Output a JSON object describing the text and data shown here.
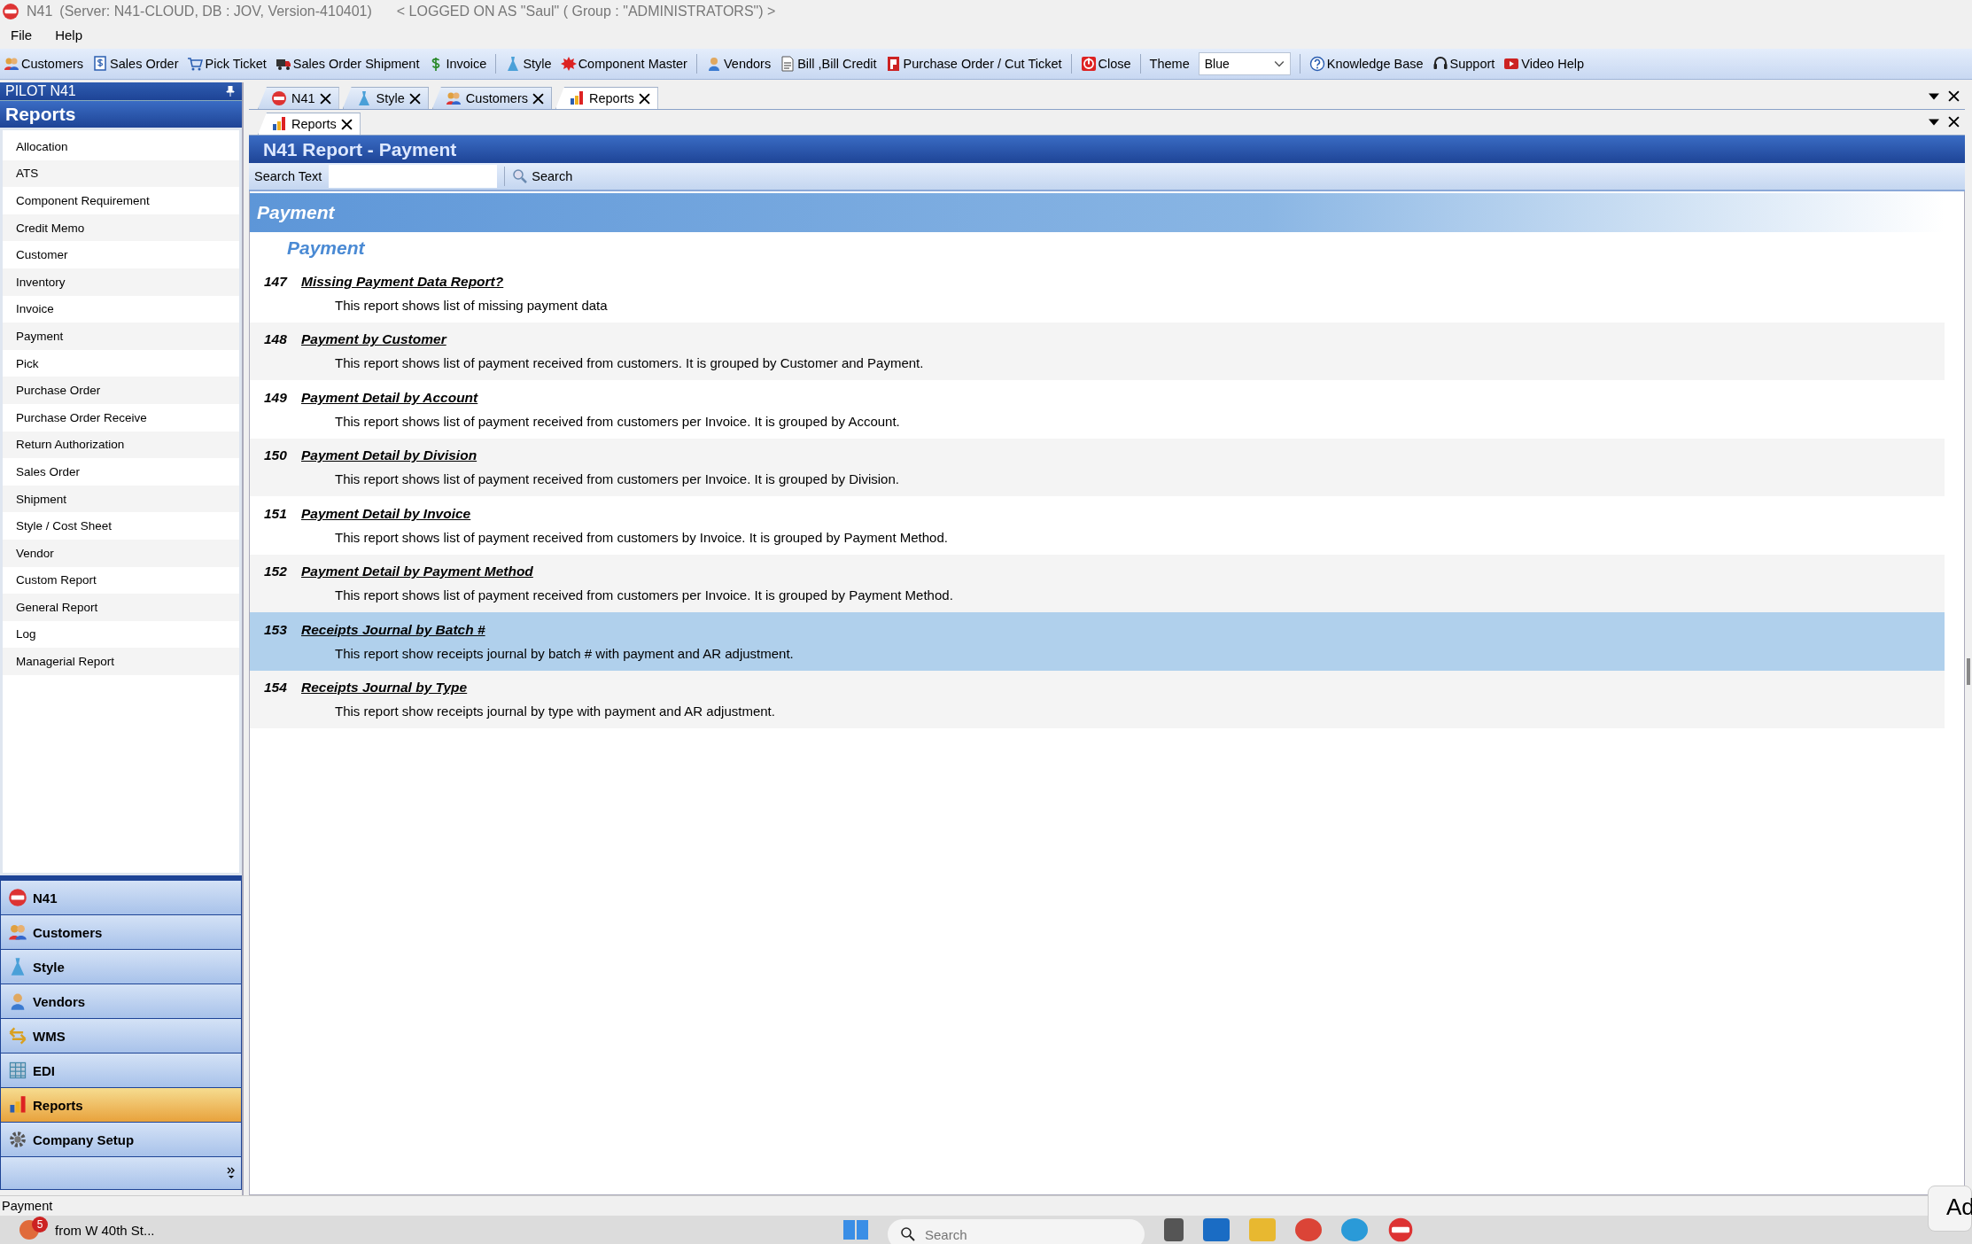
{
  "window": {
    "app": "N41",
    "title": "(Server: N41-CLOUD, DB : JOV, Version-410401)",
    "login": "< LOGGED ON AS \"Saul\" ( Group : \"ADMINISTRATORS\") >"
  },
  "menu": [
    "File",
    "Help"
  ],
  "toolbar": [
    {
      "kind": "people",
      "label": "Customers"
    },
    {
      "kind": "dollar-doc",
      "label": "Sales Order"
    },
    {
      "kind": "cart",
      "label": "Pick Ticket"
    },
    {
      "kind": "truck",
      "label": "Sales Order Shipment"
    },
    {
      "kind": "dollar",
      "label": "Invoice"
    },
    {
      "kind": "sep"
    },
    {
      "kind": "dress",
      "label": "Style"
    },
    {
      "kind": "burst",
      "label": "Component Master"
    },
    {
      "kind": "sep"
    },
    {
      "kind": "person",
      "label": "Vendors"
    },
    {
      "kind": "doc",
      "label": "Bill ,Bill Credit"
    },
    {
      "kind": "p",
      "label": "Purchase Order / Cut Ticket"
    },
    {
      "kind": "sep"
    },
    {
      "kind": "power",
      "label": "Close"
    },
    {
      "kind": "sep"
    },
    {
      "kind": "theme",
      "label": "Theme",
      "value": "Blue"
    },
    {
      "kind": "sep"
    },
    {
      "kind": "help",
      "label": "Knowledge Base"
    },
    {
      "kind": "headset",
      "label": "Support"
    },
    {
      "kind": "video",
      "label": "Video Help"
    }
  ],
  "sidebar": {
    "header": "PILOT  N41",
    "title": "Reports",
    "items": [
      "Allocation",
      "ATS",
      "Component Requirement",
      "Credit Memo",
      "Customer",
      "Inventory",
      "Invoice",
      "Payment",
      "Pick",
      "Purchase Order",
      "Purchase Order Receive",
      "Return Authorization",
      "Sales Order",
      "Shipment",
      "Style / Cost Sheet",
      "Vendor",
      "Custom Report",
      "General Report",
      "Log",
      "Managerial Report"
    ],
    "nav": [
      {
        "kind": "n41",
        "label": "N41",
        "selected": false
      },
      {
        "kind": "people",
        "label": "Customers",
        "selected": false
      },
      {
        "kind": "dress",
        "label": "Style",
        "selected": false
      },
      {
        "kind": "person",
        "label": "Vendors",
        "selected": false
      },
      {
        "kind": "arrows",
        "label": "WMS",
        "selected": false
      },
      {
        "kind": "grid",
        "label": "EDI",
        "selected": false
      },
      {
        "kind": "chart",
        "label": "Reports",
        "selected": true
      },
      {
        "kind": "gear",
        "label": "Company Setup",
        "selected": false
      }
    ]
  },
  "tabs": [
    {
      "kind": "n41",
      "label": "N41",
      "selected": false
    },
    {
      "kind": "dress",
      "label": "Style",
      "selected": false
    },
    {
      "kind": "people",
      "label": "Customers",
      "selected": false
    },
    {
      "kind": "chart",
      "label": "Reports",
      "selected": true
    }
  ],
  "subtabs": [
    {
      "kind": "chart",
      "label": "Reports",
      "selected": true
    }
  ],
  "report": {
    "title": "N41 Report - Payment",
    "search_label": "Search Text",
    "search_button": "Search",
    "banner": "Payment",
    "group": "Payment",
    "rows": [
      {
        "number": "147",
        "name": "Missing Payment Data Report?",
        "description": "This report shows list of missing payment data",
        "selected": false
      },
      {
        "number": "148",
        "name": "Payment by Customer",
        "description": "This report shows list of payment received from customers. It is grouped by Customer and Payment.",
        "selected": false
      },
      {
        "number": "149",
        "name": "Payment Detail by Account",
        "description": "This report shows list of payment received from customers per Invoice. It is grouped by Account.",
        "selected": false
      },
      {
        "number": "150",
        "name": "Payment Detail by Division",
        "description": "This report shows list of payment received from customers per Invoice. It is grouped by Division.",
        "selected": false
      },
      {
        "number": "151",
        "name": "Payment Detail by Invoice",
        "description": "This report shows list of payment received from customers by Invoice. It is grouped by Payment Method.",
        "selected": false
      },
      {
        "number": "152",
        "name": "Payment Detail by Payment Method",
        "description": "This report shows list of payment received from customers per Invoice. It is grouped by Payment Method.",
        "selected": false
      },
      {
        "number": "153",
        "name": "Receipts Journal by Batch #",
        "description": "This report show receipts journal by batch # with payment and AR adjustment.",
        "selected": true
      },
      {
        "number": "154",
        "name": "Receipts Journal by Type",
        "description": "This report show receipts journal by type with payment and AR adjustment.",
        "selected": false
      }
    ]
  },
  "status_bar": "Payment",
  "taskbar": {
    "badge": "5",
    "notification": "from W 40th St...",
    "search_placeholder": "Search",
    "popup": "Ad"
  }
}
